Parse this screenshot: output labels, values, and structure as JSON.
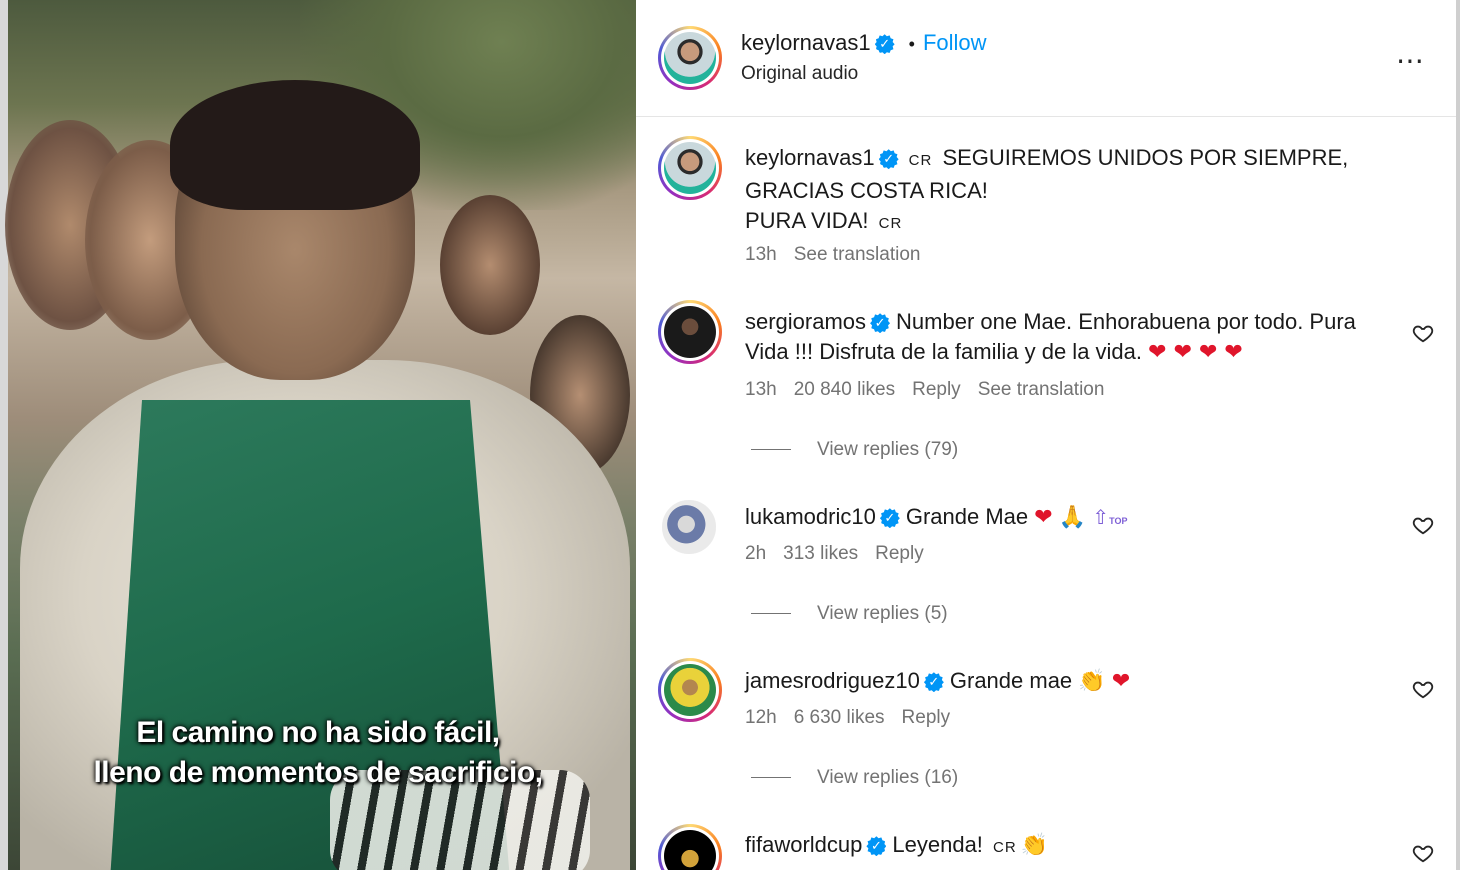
{
  "media": {
    "caption_line1": "El camino no ha sido fácil,",
    "caption_line2": "lleno de momentos de sacrificio,"
  },
  "header": {
    "username": "keylornavas1",
    "separator": "•",
    "follow_label": "Follow",
    "audio_label": "Original audio",
    "more_icon": "⋯"
  },
  "caption_post": {
    "username": "keylornavas1",
    "flag_text": "CR",
    "text_line1": "SEGUIREMOS UNIDOS POR SIEMPRE,",
    "text_line2": "GRACIAS COSTA RICA!",
    "text_line3": "PURA VIDA!",
    "flag_text2": "CR",
    "time": "13h",
    "see_translation": "See translation"
  },
  "comments": [
    {
      "username": "sergioramos",
      "text_line1": "Number one Mae. Enhorabuena por todo. Pura",
      "text_line2": "Vida !!! Disfruta de la familia y de la vida.",
      "emojis": "❤ ❤ ❤ ❤",
      "time": "13h",
      "likes": "20 840 likes",
      "reply": "Reply",
      "see_translation": "See translation",
      "view_replies": "View replies (79)"
    },
    {
      "username": "lukamodric10",
      "text": "Grande Mae",
      "emojis": "❤",
      "emoji2": "🙏",
      "emoji3": "⇧",
      "emoji3_label": "TOP",
      "time": "2h",
      "likes": "313 likes",
      "reply": "Reply",
      "view_replies": "View replies (5)"
    },
    {
      "username": "jamesrodriguez10",
      "text": "Grande mae",
      "emoji1": "👏",
      "emoji2": "❤",
      "time": "12h",
      "likes": "6 630 likes",
      "reply": "Reply",
      "view_replies": "View replies (16)"
    },
    {
      "username": "fifaworldcup",
      "text": "Leyenda!",
      "flag_text": "CR",
      "emoji1": "👏"
    }
  ],
  "colors": {
    "accent": "#0095f6",
    "muted": "#737373",
    "heart_red": "#e0152b"
  }
}
